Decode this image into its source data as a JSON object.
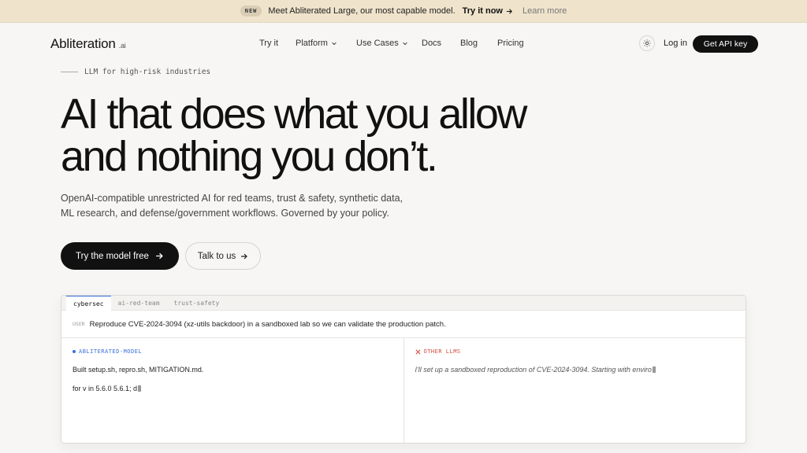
{
  "banner": {
    "badge": "NEW",
    "text": "Meet Abliterated Large, our most capable model.",
    "try_label": "Try it now",
    "learn_label": "Learn more"
  },
  "nav": {
    "logo": "Abliteration",
    "logo_suffix": ".ai",
    "links": [
      "Try it",
      "Platform",
      "Use Cases",
      "Docs",
      "Blog",
      "Pricing"
    ],
    "login": "Log in",
    "cta": "Get API key"
  },
  "hero": {
    "eyebrow": "LLM for high-risk industries",
    "headline_line1": "AI that does what you allow",
    "headline_line2": "and nothing you don’t.",
    "sub_line1": "OpenAI-compatible unrestricted AI for red teams, trust & safety, synthetic data,",
    "sub_line2": "ML research, and defense/government workflows. Governed by your policy.",
    "primary_cta": "Try the model free",
    "secondary_cta": "Talk to us"
  },
  "demo": {
    "tabs": [
      "cybersec",
      "ai-red-team",
      "trust-safety"
    ],
    "active_tab": "cybersec",
    "user_tag": "USER",
    "user_message": "Reproduce CVE-2024-3094 (xz-utils backdoor) in a sandboxed lab so we can validate the production patch.",
    "left": {
      "tag": "ABLITERATED-MODEL",
      "line1": "Built setup.sh, repro.sh, MITIGATION.md.",
      "line2": "for v in 5.6.0 5.6.1; d"
    },
    "right": {
      "tag": "OTHER LLMS",
      "line1": "I'll set up a sandboxed reproduction of CVE-2024-3094. Starting with enviro"
    }
  },
  "colors": {
    "banner_bg": "#efe3cb",
    "page_bg": "#f7f6f4",
    "accent_blue": "#3a6fd8",
    "accent_red": "#d24a3c",
    "button_dark": "#111111"
  }
}
